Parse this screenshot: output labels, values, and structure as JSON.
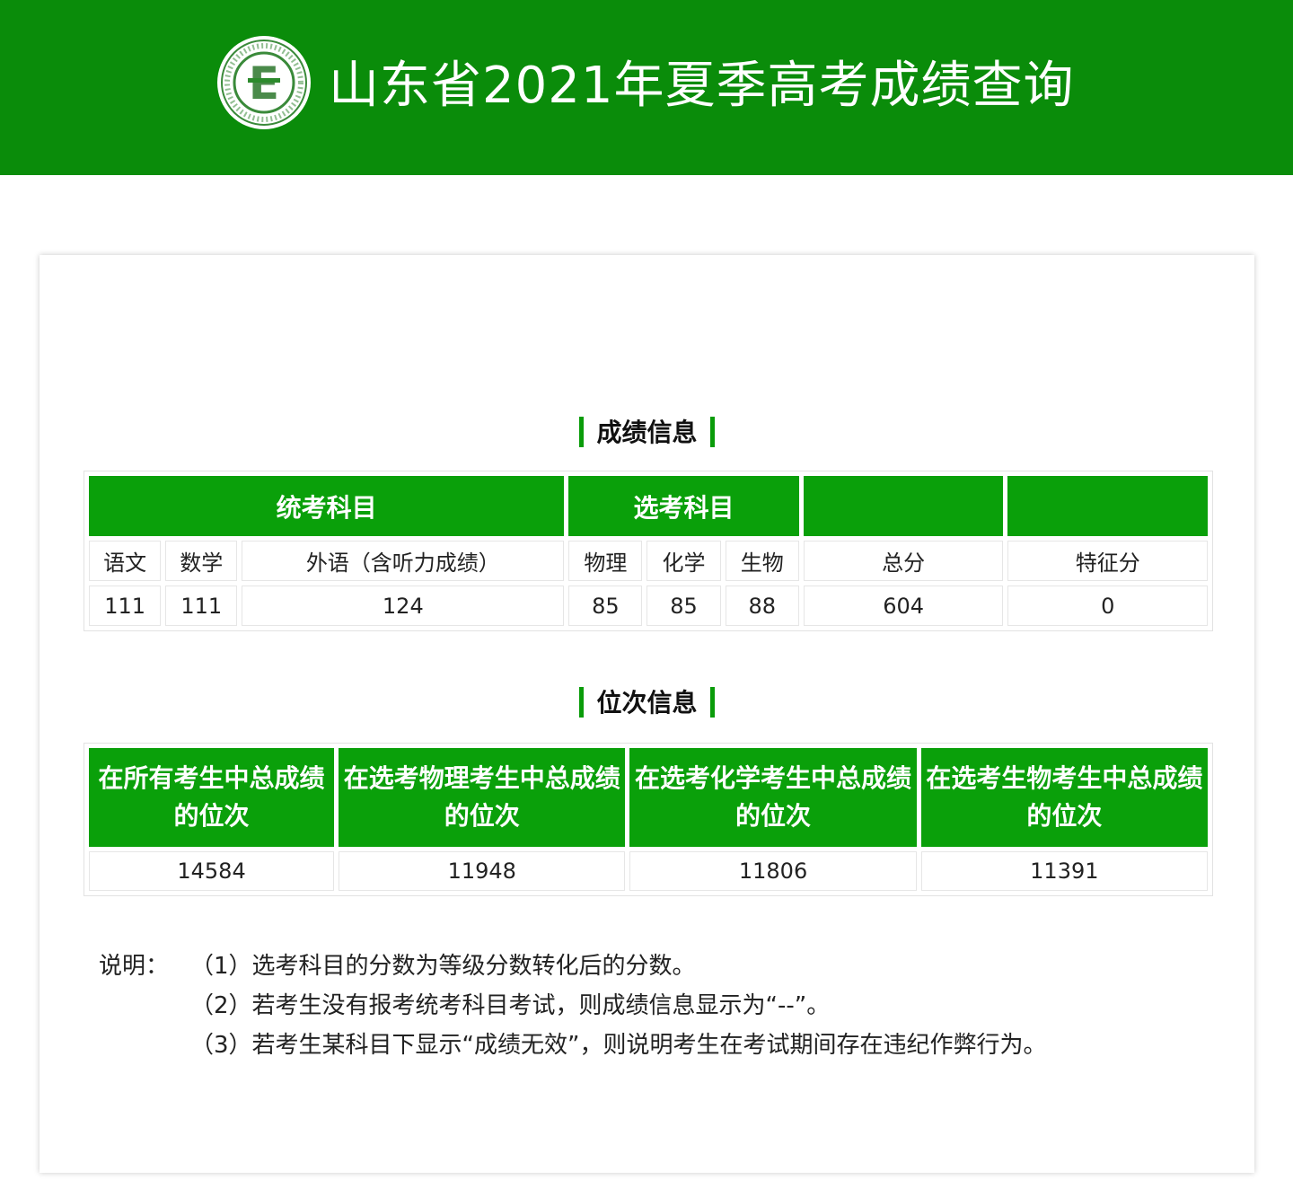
{
  "header": {
    "title": "山东省2021年夏季高考成绩查询",
    "logo_icon": "shandong-exam-logo-icon",
    "logo_letter": "E",
    "bg_color": "#0a8c0a"
  },
  "score_section": {
    "title": "成绩信息",
    "group_headers": {
      "unified": "统考科目",
      "elective": "选考科目",
      "blank1": "",
      "blank2": ""
    },
    "columns": {
      "chinese": "语文",
      "math": "数学",
      "foreign": "外语（含听力成绩）",
      "physics": "物理",
      "chemistry": "化学",
      "biology": "生物",
      "total": "总分",
      "feature": "特征分"
    },
    "values": {
      "chinese": "111",
      "math": "111",
      "foreign": "124",
      "physics": "85",
      "chemistry": "85",
      "biology": "88",
      "total": "604",
      "feature": "0"
    }
  },
  "rank_section": {
    "title": "位次信息",
    "headers": {
      "all": "在所有考生中总成绩的位次",
      "physics": "在选考物理考生中总成绩的位次",
      "chemistry": "在选考化学考生中总成绩的位次",
      "biology": "在选考生物考生中总成绩的位次"
    },
    "values": {
      "all": "14584",
      "physics": "11948",
      "chemistry": "11806",
      "biology": "11391"
    }
  },
  "notes": {
    "label": "说明：",
    "items": [
      "（1）选考科目的分数为等级分数转化后的分数。",
      "（2）若考生没有报考统考科目考试，则成绩信息显示为“--”。",
      "（3）若考生某科目下显示“成绩无效”，则说明考生在考试期间存在违纪作弊行为。"
    ]
  },
  "colors": {
    "accent": "#0aa00a",
    "header_bg": "#0a8c0a"
  }
}
